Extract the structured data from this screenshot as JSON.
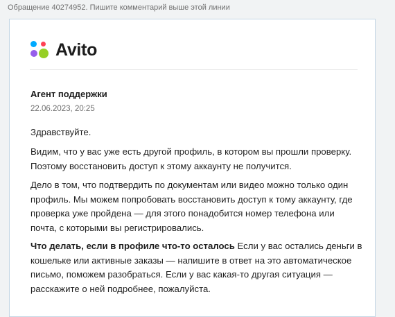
{
  "top_note": "Обращение 40274952. Пишите комментарий выше этой линии",
  "brand": {
    "name": "Avito",
    "logo_icon": "avito-four-dots-logo",
    "logo_colors": [
      "#00aaff",
      "#ff4053",
      "#965eeb",
      "#97cf26"
    ]
  },
  "message": {
    "sender": "Агент поддержки",
    "timestamp": "22.06.2023, 20:25",
    "greeting": "Здравствуйте.",
    "paragraph_1": "Видим, что у вас уже есть другой профиль, в котором вы прошли проверку. Поэтому восстановить доступ к этому аккаунту не получится.",
    "paragraph_2": "Дело в том, что подтвердить по документам или видео можно только один профиль. Мы можем попробовать восстановить доступ к тому аккаунту, где проверка уже пройдена — для этого понадобится номер телефона или почта, с которыми вы регистрировались.",
    "paragraph_3_heading": "Что делать, если в профиле что-то осталось",
    "paragraph_3_text": " Если у вас остались деньги в кошельке или активные заказы — напишите в ответ на это автоматическое письмо, поможем разобраться. Если у вас какая-то другая ситуация — расскажите о ней подробнее, пожалуйста."
  }
}
